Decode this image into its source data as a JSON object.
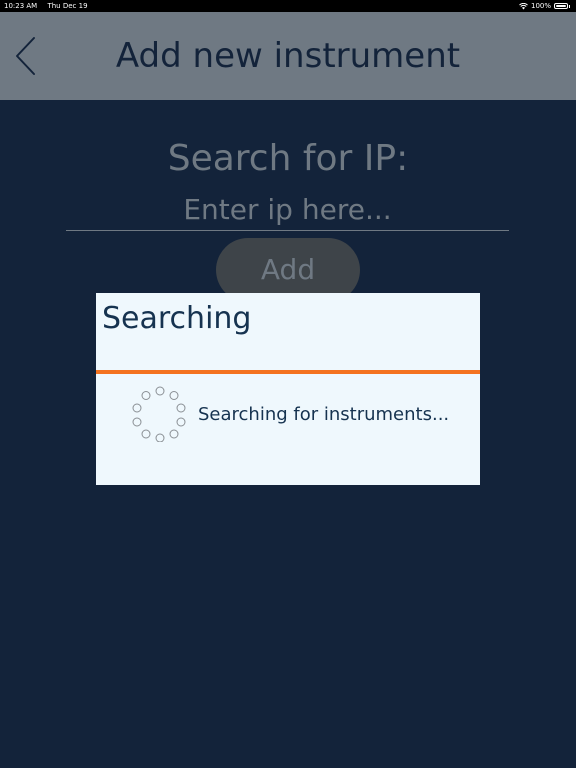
{
  "status_bar": {
    "time": "10:23 AM",
    "date": "Thu Dec 19",
    "battery": "100%",
    "wifi_icon": "wifi-icon",
    "battery_icon": "battery-icon"
  },
  "nav": {
    "title": "Add new instrument",
    "back_icon": "chevron-left-icon"
  },
  "form": {
    "label": "Search for IP:",
    "ip_placeholder": "Enter ip here...",
    "ip_value": "",
    "add_label": "Add"
  },
  "dialog": {
    "title": "Searching",
    "message": "Searching for instruments...",
    "accent_color": "#f47320",
    "spinner_icon": "loading-spinner-icon"
  },
  "colors": {
    "background": "#13233a",
    "nav_background": "#6f7983",
    "dialog_background": "#eff8fd",
    "text_dark": "#163350"
  }
}
